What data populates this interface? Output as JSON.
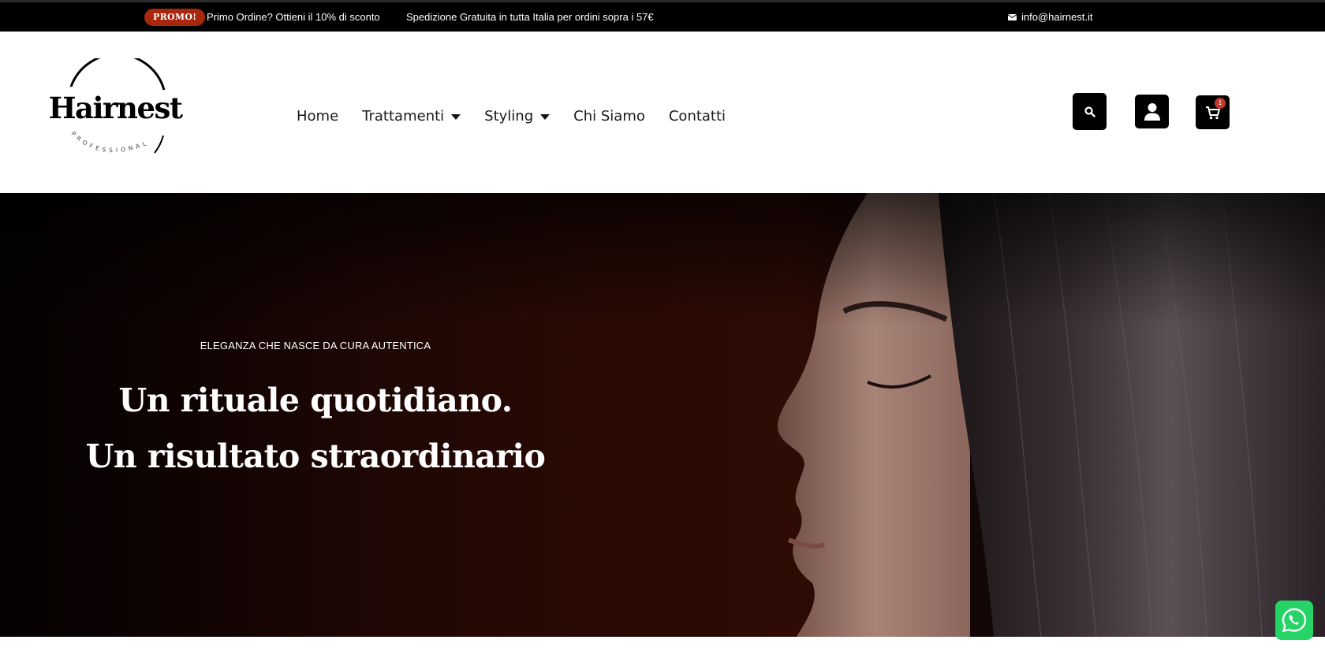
{
  "topbar": {
    "promo_badge": "PROMO!",
    "offer_text": "Primo Ordine? Ottieni il 10% di sconto",
    "shipping_text": "Spedizione Gratuita in tutta Italia per ordini sopra i 57€",
    "email_icon": "envelope-icon",
    "email": "info@hairnest.it",
    "badge_color": "#a8270f"
  },
  "header": {
    "logo": {
      "brand": "Hairnest",
      "tagline": "PROFESSIONAL"
    },
    "nav": [
      {
        "label": "Home",
        "has_dropdown": false
      },
      {
        "label": "Trattamenti",
        "has_dropdown": true
      },
      {
        "label": "Styling",
        "has_dropdown": true
      },
      {
        "label": "Chi Siamo",
        "has_dropdown": false
      },
      {
        "label": "Contatti",
        "has_dropdown": false
      }
    ],
    "icons": {
      "search": "search-icon",
      "account": "user-icon",
      "cart": "cart-icon",
      "cart_count": "1"
    }
  },
  "hero": {
    "eyebrow": "ELEGANZA CHE NASCE DA CURA AUTENTICA",
    "title_line1": "Un rituale quotidiano.",
    "title_line2": "Un risultato straordinario",
    "accent_color": "#2e0b05"
  },
  "floating": {
    "whatsapp": "whatsapp-icon",
    "color": "#25d366"
  }
}
